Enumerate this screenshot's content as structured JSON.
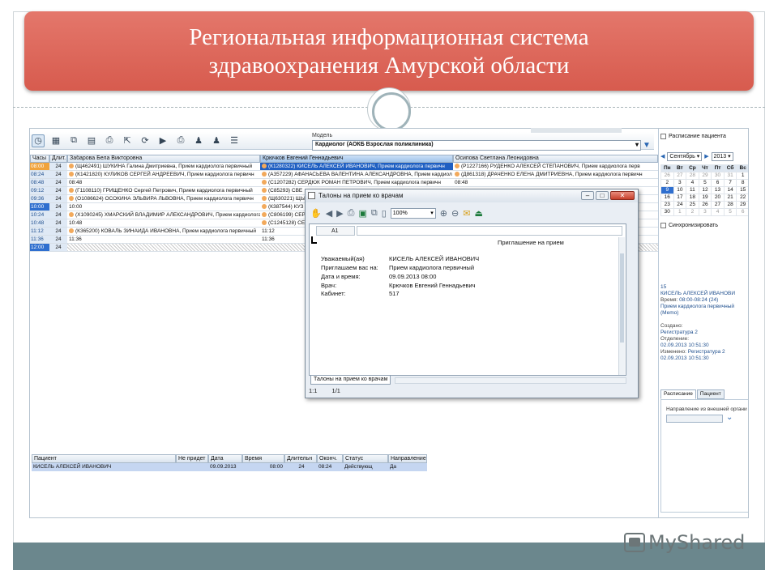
{
  "slide": {
    "title_line1": "Региональная информационная система",
    "title_line2": "здравоохранения Амурской области",
    "watermark": "MyShared"
  },
  "app": {
    "model_label": "Модель",
    "model_value": "Кардиолог  (АОКБ Взрослая поликлиника)",
    "columns": [
      {
        "label": "Часы"
      },
      {
        "label": "Длит."
      },
      {
        "label": "Забарова Бела Викторовна"
      },
      {
        "label": "Крючков Евгений Геннадьевич"
      },
      {
        "label": "Осипова Светлана Леонидовна"
      }
    ],
    "rows": [
      {
        "time": "08:00",
        "dur": "24",
        "c1": "(Щ462491) ШУКИНА Галина Дмитриевна, Прием кардиолога первичный",
        "c2": "(К1280322) КИСЕЛЬ АЛЕКСЕЙ ИВАНОВИЧ, Прием кардиолога первичн",
        "c3": "(Р1227166) РУДЕНКО АЛЕКСЕЙ СТЕПАНОВИЧ, Прием кардиолога перв"
      },
      {
        "time": "08:24",
        "dur": "24",
        "c1": "(К1421820) КУЛИКОВ СЕРГЕЙ АНДРЕЕВИЧ, Прием кардиолога первичн",
        "c2": "(А357229) АФАНАСЬЕВА ВАЛЕНТИНА АЛЕКСАНДРОВНА, Прием кардиол",
        "c3": "(Д861318) ДРАЧЕНКО ЕЛЕНА ДМИТРИЕВНА, Прием кардиолога первичн"
      },
      {
        "time": "08:48",
        "dur": "24",
        "c1": "08:48",
        "c2": "(С1207282) СЕРДЮК РОМАН ПЕТРОВИЧ, Прием кардиолога первичн",
        "c3": "08:48"
      },
      {
        "time": "09:12",
        "dur": "24",
        "c1": "(Г1108110) ГРИЩЕНКО Сергей Петрович, Прием кардиолога первичный",
        "c2": "(С85293) СВЕ",
        "c3": ""
      },
      {
        "time": "09:36",
        "dur": "24",
        "c1": "(О1086624) ОСОКИНА ЭЛЬВИРА ЛЬВОВНА, Прием кардиолога первичн",
        "c2": "(Щ630221) ЩЫ",
        "c3": ""
      },
      {
        "time": "10:00",
        "dur": "24",
        "c1": "10:00",
        "c2": "(К387544) КУЗ",
        "c3": ""
      },
      {
        "time": "10:24",
        "dur": "24",
        "c1": "(Х1090245) ХМАРСКИЙ ВЛАДИМИР АЛЕКСАНДРОВИЧ, Прием кардиолога",
        "c2": "(С806199) СЕР",
        "c3": ""
      },
      {
        "time": "10:48",
        "dur": "24",
        "c1": "10:48",
        "c2": "(С1245128) СЕ",
        "c3": ""
      },
      {
        "time": "11:12",
        "dur": "24",
        "c1": "(К365200) КОВАЛЬ ЗИНАИДА ИВАНОВНА, Прием кардиолога первичный",
        "c2": "11:12",
        "c3": ""
      },
      {
        "time": "11:36",
        "dur": "24",
        "c1": "11:36",
        "c2": "11:36",
        "c3": ""
      },
      {
        "time": "12:00",
        "dur": "24",
        "c1": "",
        "c2": "",
        "c3": ""
      }
    ],
    "patients_headers": [
      "Пациент",
      "Не придет",
      "Дата",
      "Время",
      "Длительн",
      "Оконч.",
      "Статус",
      "Направление"
    ],
    "patients_row": [
      "КИСЕЛЬ АЛЕКСЕЙ ИВАНОВИЧ",
      "",
      "09.09.2013",
      "08:00",
      "24",
      "08:24",
      "Действующ",
      "Да"
    ]
  },
  "side": {
    "schedule_checkbox": "Расписание пациента",
    "month": "Сентябрь",
    "year": "2013",
    "weekdays": [
      "Пн",
      "Вт",
      "Ср",
      "Чт",
      "Пт",
      "Сб",
      "Вс"
    ],
    "weeks": [
      [
        "26",
        "27",
        "28",
        "29",
        "30",
        "31",
        "1"
      ],
      [
        "2",
        "3",
        "4",
        "5",
        "6",
        "7",
        "8"
      ],
      [
        "9",
        "10",
        "11",
        "12",
        "13",
        "14",
        "15"
      ],
      [
        "16",
        "17",
        "18",
        "19",
        "20",
        "21",
        "22"
      ],
      [
        "23",
        "24",
        "25",
        "26",
        "27",
        "28",
        "29"
      ],
      [
        "30",
        "1",
        "2",
        "3",
        "4",
        "5",
        "6"
      ]
    ],
    "sync_label": "Синхронизировать",
    "info_num": "15",
    "info_name": "КИСЕЛЬ АЛЕКСЕЙ ИВАНОВИ",
    "info_time_label": "Время: ",
    "info_time": "08:00-08:24 (24)",
    "info_service": "Прием кардиолога первичный",
    "info_memo": "(Memo)",
    "created_label": "Создано:",
    "created_value": "Регистратура 2",
    "dept_label": "Отделение:",
    "created_date": "02.09.2013 10:51:30",
    "changed_label": "Изменено: ",
    "changed_value": "Регистратура 2",
    "changed_date": "02.09.2013 10:51:30",
    "tab_schedule": "Расписание",
    "tab_patient": "Пациент",
    "direction_label": "Направление из внешней органи"
  },
  "dialog": {
    "title": "Талоны на прием ко врачам",
    "zoom": "100%",
    "cell_ref": "A1",
    "heading": "Приглашение на прием",
    "labels": [
      "Уважаемый(ая)",
      "Приглашаем вас на:",
      "Дата и время:",
      "Врач:",
      "Кабинет:"
    ],
    "values": [
      "КИСЕЛЬ АЛЕКСЕЙ ИВАНОВИЧ",
      "Прием кардиолога первичный",
      "09.09.2013 08:00",
      "Крючков Евгений Геннадьевич",
      "517"
    ],
    "sheet_tab": "Талоны на прием ко врачам",
    "page_status": "1:1",
    "page_count": "1/1"
  }
}
